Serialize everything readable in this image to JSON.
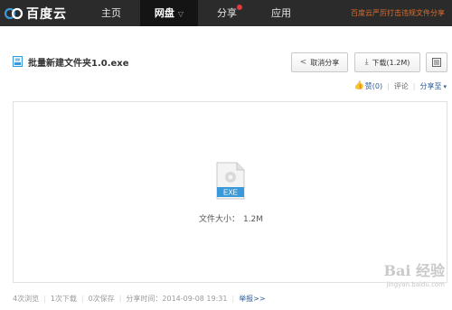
{
  "nav": {
    "logo_text": "百度云",
    "items": [
      {
        "label": "主页"
      },
      {
        "label": "网盘"
      },
      {
        "label": "分享"
      },
      {
        "label": "应用"
      }
    ],
    "promo_text": "百度云严厉打击违规文件分享"
  },
  "file": {
    "name": "批量新建文件夹1.0.exe",
    "type_label": "EXE",
    "size_label": "文件大小：",
    "size_value": "1.2M"
  },
  "toolbar": {
    "unshare_label": "取消分享",
    "download_label": "下载(1.2M)"
  },
  "actions": {
    "like_label": "赞(0)",
    "comment_label": "评论",
    "share_to_label": "分享至"
  },
  "stats": {
    "views": "4次浏览",
    "downloads": "1次下载",
    "saves": "0次保存",
    "share_time": "分享时间：2014-09-08 19:31",
    "report": "举报>>"
  },
  "watermark": {
    "main": "Bai 经验",
    "sub": "jingyan.baidu.com"
  },
  "colors": {
    "topbar": "#2b2b2b",
    "active_nav": "#141414",
    "link": "#2f5c9a",
    "promo": "#e06c2a",
    "exe_badge": "#3a9ad9"
  }
}
